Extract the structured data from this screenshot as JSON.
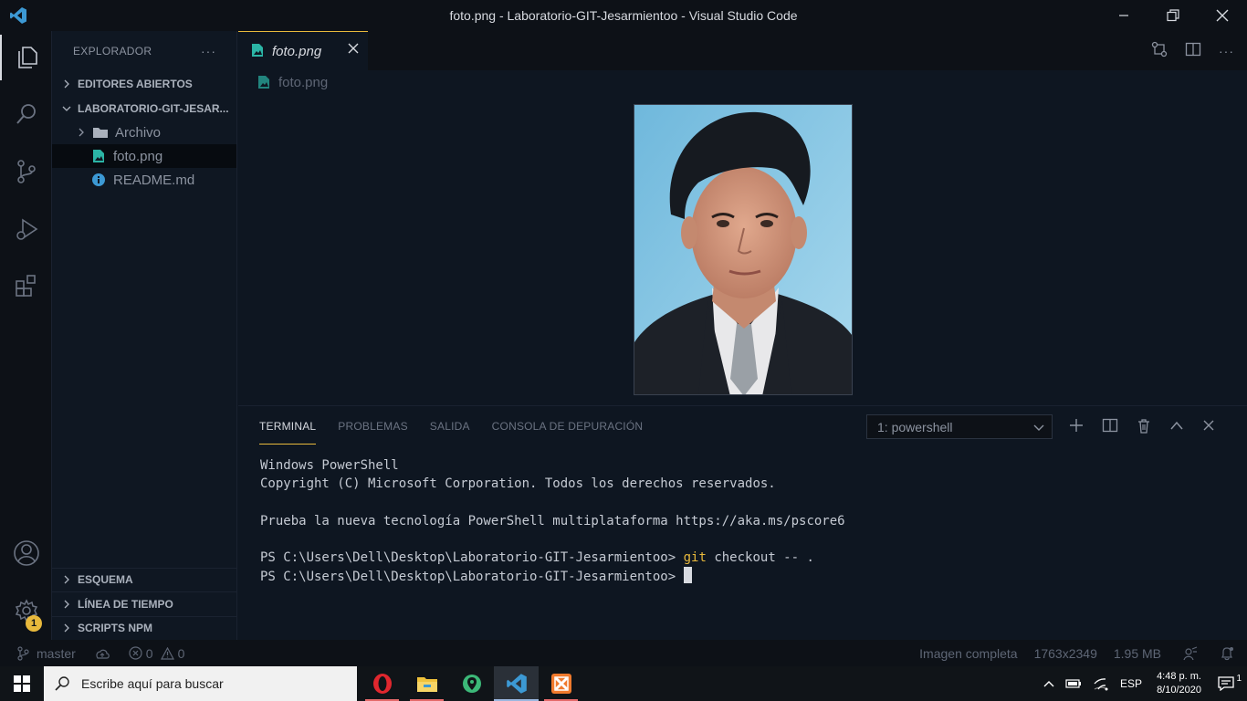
{
  "window": {
    "title": "foto.png - Laboratorio-GIT-Jesarmientoo - Visual Studio Code"
  },
  "sidebar": {
    "header": "EXPLORADOR",
    "sections": {
      "open_editors": "EDITORES ABIERTOS",
      "project": "LABORATORIO-GIT-JESAR...",
      "outline": "ESQUEMA",
      "timeline": "LÍNEA DE TIEMPO",
      "npm_scripts": "SCRIPTS NPM"
    },
    "tree": [
      {
        "label": "Archivo",
        "icon": "folder-icon"
      },
      {
        "label": "foto.png",
        "icon": "image-file-icon",
        "selected": true
      },
      {
        "label": "README.md",
        "icon": "info-icon"
      }
    ]
  },
  "activity": {
    "settings_badge": "1"
  },
  "editor": {
    "tab_label": "foto.png",
    "breadcrumb": "foto.png"
  },
  "panel": {
    "tabs": [
      "TERMINAL",
      "PROBLEMAS",
      "SALIDA",
      "CONSOLA DE DEPURACIÓN"
    ],
    "active_tab": "TERMINAL",
    "shell_selector": "1: powershell",
    "terminal": {
      "line1": "Windows PowerShell",
      "line2": "Copyright (C) Microsoft Corporation. Todos los derechos reservados.",
      "line3": "Prueba la nueva tecnología PowerShell multiplataforma https://aka.ms/pscore6",
      "prompt": "PS C:\\Users\\Dell\\Desktop\\Laboratorio-GIT-Jesarmientoo>",
      "cmd_keyword": "git",
      "cmd_rest": " checkout -- ."
    }
  },
  "statusbar": {
    "branch": "master",
    "errors": "0",
    "warnings": "0",
    "image_mode": "Imagen completa",
    "dimensions": "1763x2349",
    "file_size": "1.95 MB"
  },
  "taskbar": {
    "search_placeholder": "Escribe aquí para buscar",
    "language": "ESP",
    "time": "4:48 p. m.",
    "date": "8/10/2020",
    "notifications": "1"
  },
  "colors": {
    "accent": "#e8b93c",
    "background": "#0e1621",
    "vscode_blue": "#3c99d4"
  }
}
